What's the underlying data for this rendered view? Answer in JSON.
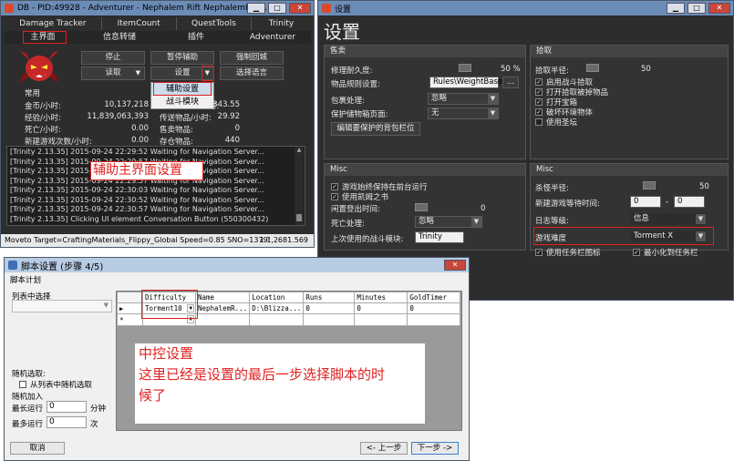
{
  "db": {
    "title": "DB - PID:49928 - Adventurer - Nephalem Rift NephalemRift...",
    "top_tabs": [
      "Damage Tracker",
      "ItemCount",
      "QuestTools",
      "Trinity"
    ],
    "sub_tabs": [
      "主界面",
      "信息转储",
      "插件",
      "Adventurer"
    ],
    "buttons": {
      "stop": "停止",
      "pause": "暂停辅助",
      "force_town": "强制回城",
      "read": "读取",
      "settings": "设置",
      "language": "选择语言"
    },
    "dropdown": [
      "辅助设置",
      "战斗模块"
    ],
    "stats_header": "常用",
    "stats": [
      {
        "label": "金币/小时:",
        "value": "10,137,218"
      },
      {
        "label": "经验/小时:",
        "value": "11,839,063,393"
      },
      {
        "label": "死亡/小时:",
        "value": "0.00"
      },
      {
        "label": "新建游戏次数/小时:",
        "value": "0.00"
      }
    ],
    "stats_right": [
      {
        "label": "时:",
        "value": "343.55"
      },
      {
        "label": "传送物品/小时:",
        "value": "29.92"
      },
      {
        "label": "售卖物品:",
        "value": "0"
      },
      {
        "label": "存仓物品:",
        "value": "440"
      }
    ],
    "log": [
      "[Trinity 2.13.35] 2015-09-24 22:29:52 Waiting for Navigation Server...",
      "[Trinity 2.13.35] 2015-09-24 22:29:57 Waiting for Navigation Server...",
      "[Trinity 2.13.35] 2015-09-24 22:30:02 Waiting for Navigation Server...",
      "[Trinity 2.13.35] 2015-09-24 22:29:57 Waiting for Navigation Server...",
      "[Trinity 2.13.35] 2015-09-24 22:30:03 Waiting for Navigation Server...",
      "[Trinity 2.13.35] 2015-09-24 22:30:52 Waiting for Navigation Server...",
      "[Trinity 2.13.35] 2015-09-24 22:30:57 Waiting for Navigation Server...",
      "[Trinity 2.13.35] Clicking UI element Conversation Button (550300432)"
    ],
    "annotation": "辅助主界面设置",
    "status_left": "Moveto Target=CraftingMaterials_Flippy_Global Speed=0.85 SNO=1379!",
    "status_right": "1.1,2681.569"
  },
  "settings": {
    "title": "设置",
    "heading": "设置",
    "sections": {
      "sell": {
        "title": "售卖",
        "repair_label": "修理耐久度:",
        "repair_value": "50 %",
        "item_rules_label": "物品规则设置:",
        "item_rules_value": "Rules\\WeightBased",
        "item_rules_btn": "...",
        "pack_label": "包裹处理:",
        "pack_value": "忽略",
        "protect_label": "保护储物箱页面:",
        "protect_value": "无",
        "edit_btn": "编辑要保护的背包栏位"
      },
      "pickup": {
        "title": "拾取",
        "radius_label": "拾取半径:",
        "radius_value": "50",
        "checks": [
          "启用战斗拾取",
          "打开拾取被掉物品",
          "打开宝箱",
          "破坏环境物体",
          "使用圣坛"
        ]
      },
      "misc_left": {
        "title": "Misc",
        "checks": [
          "游戏始终保持在前台运行",
          "使用凯姆之书"
        ],
        "idle_label": "闲置登出时间:",
        "idle_value": "0",
        "death_label": "死亡处理:",
        "death_value": "忽略",
        "combat_label": "上次使用的战斗模块:",
        "combat_value": "Trinity"
      },
      "misc_right": {
        "title": "Misc",
        "kill_label": "杀怪半径:",
        "kill_value": "50",
        "newgame_label": "新建游戏等待时间:",
        "newgame_from": "0",
        "newgame_sep": "-",
        "newgame_to": "0",
        "log_label": "日志等级:",
        "log_value": "信息",
        "difficulty_label": "游戏难度",
        "difficulty_value": "Torment X",
        "checks": [
          "使用任务栏图标",
          "最小化到任务栏"
        ]
      }
    }
  },
  "script": {
    "title": "脚本设置 (步骤 4/5)",
    "group": "脚本计划",
    "list_label": "列表中选择",
    "random_label": "随机选取:",
    "random_check": "从列表中随机选取",
    "random_add": "随机加入",
    "max_run_label": "最长运行",
    "max_run_value": "0",
    "max_run_unit": "分钟",
    "max_times_label": "最多运行",
    "max_times_value": "0",
    "max_times_unit": "次",
    "columns": [
      "Difficulty",
      "Name",
      "Location",
      "Runs",
      "Minutes",
      "GoldTimer"
    ],
    "row": [
      "Torment10",
      "NephalemR...",
      "D:\\Blizza...",
      "0",
      "0",
      "0"
    ],
    "row_marker": "▶",
    "new_marker": "*",
    "annotation_1": "中控设置",
    "annotation_2": "这里已经是设置的最后一步选择脚本的时",
    "annotation_3": "候了",
    "cancel": "取消",
    "prev": "<- 上一步",
    "next": "下一步 ->"
  },
  "colors": {
    "accent_red": "#e02020",
    "titlebar": "#6c8cb8",
    "dark_bg": "#2d2d2d"
  }
}
